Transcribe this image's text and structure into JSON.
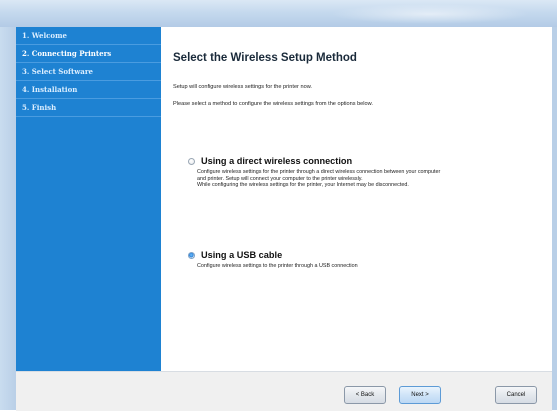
{
  "sidebar": {
    "items": [
      {
        "label": "1. Welcome",
        "active": false
      },
      {
        "label": "2. Connecting Printers",
        "active": true
      },
      {
        "label": "3. Select Software",
        "active": false
      },
      {
        "label": "4. Installation",
        "active": false
      },
      {
        "label": "5. Finish",
        "active": false
      }
    ]
  },
  "main": {
    "title": "Select the Wireless Setup Method",
    "subtitle_1": "Setup will configure wireless settings for the printer now.",
    "subtitle_2": "Please select a method to configure the wireless settings from the options below.",
    "options": [
      {
        "label": "Using a direct wireless connection",
        "selected": false,
        "desc": [
          "Configure wireless settings for the printer through a direct wireless connection between your computer",
          "and printer. Setup will connect your computer to the printer wirelessly.",
          "While configuring the wireless settings for the printer, your Internet may be disconnected."
        ]
      },
      {
        "label": "Using a USB cable",
        "selected": true,
        "desc": [
          "Configure wireless settings to the printer through a USB connection"
        ]
      }
    ]
  },
  "footer": {
    "back_label": "< Back",
    "next_label": "Next >",
    "cancel_label": "Cancel"
  },
  "colors": {
    "sidebar": "#1e82d2",
    "accent": "#2a80d8"
  }
}
